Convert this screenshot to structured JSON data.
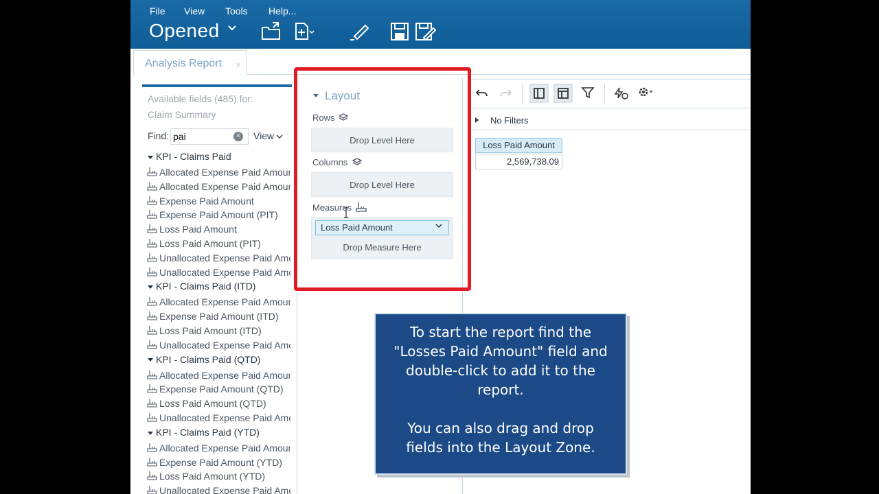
{
  "menu": {
    "file": "File",
    "view": "View",
    "tools": "Tools",
    "help": "Help..."
  },
  "header": {
    "opened_label": "Opened",
    "icons": [
      "open-folder-icon",
      "new-file-icon",
      "edit-pencil-icon",
      "save-icon",
      "save-as-icon"
    ]
  },
  "tab": {
    "label": "Analysis Report",
    "close": "×"
  },
  "field_panel": {
    "title_line1": "Available fields (485) for:",
    "title_line2": "Claim Summary",
    "find_label": "Find:",
    "find_value": "pai",
    "clear": "×",
    "view_label": "View",
    "groups": [
      {
        "name": "KPI - Claims Paid",
        "fields": [
          "Allocated Expense Paid Amount",
          "Allocated Expense Paid Amount (PIT)",
          "Expense Paid Amount",
          "Expense Paid Amount (PIT)",
          "Loss Paid Amount",
          "Loss Paid Amount (PIT)",
          "Unallocated Expense Paid Amount",
          "Unallocated Expense Paid Amount (PIT)"
        ]
      },
      {
        "name": "KPI - Claims Paid (ITD)",
        "fields": [
          "Allocated Expense Paid Amount (ITD)",
          "Expense Paid Amount (ITD)",
          "Loss Paid Amount (ITD)",
          "Unallocated Expense Paid Amount (ITD)"
        ]
      },
      {
        "name": "KPI - Claims Paid (QTD)",
        "fields": [
          "Allocated Expense Paid Amount (QTD)",
          "Expense Paid Amount (QTD)",
          "Loss Paid Amount (QTD)",
          "Unallocated Expense Paid Amount (QTD)"
        ]
      },
      {
        "name": "KPI - Claims Paid (YTD)",
        "fields": [
          "Allocated Expense Paid Amount (YTD)",
          "Expense Paid Amount (YTD)",
          "Loss Paid Amount (YTD)",
          "Unallocated Expense Paid Amount (YTD)"
        ]
      }
    ]
  },
  "layout": {
    "title": "Layout",
    "rows_label": "Rows",
    "rows_drop": "Drop Level Here",
    "columns_label": "Columns",
    "columns_drop": "Drop Level Here",
    "measures_label": "Measures",
    "measure_selected": "Loss Paid Amount",
    "measures_drop": "Drop Measure Here",
    "highlight_color": "#e01b24"
  },
  "report": {
    "toolbar_icons": [
      "undo-icon",
      "redo-icon",
      "layout-toggle-icon",
      "table-icon",
      "filter-icon",
      "refresh-settings-icon",
      "gear-icon"
    ],
    "filters_label": "No Filters",
    "column_header": "Loss Paid Amount",
    "value": "2,569,738.09"
  },
  "callout": {
    "line1": "To start the report find the",
    "line2": "\"Losses Paid Amount\" field and",
    "line3": "double-click to add it to the",
    "line4": "report.",
    "line5": "You can also drag and drop",
    "line6": "fields into the Layout Zone."
  },
  "colors": {
    "header_blue": "#1563a0",
    "accent_red": "#e01b24",
    "callout_bg": "#1c4a86"
  }
}
